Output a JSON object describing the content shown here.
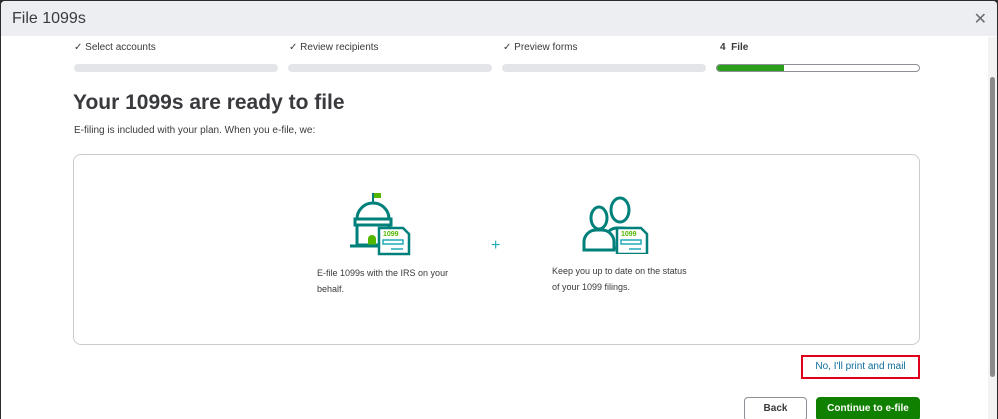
{
  "window": {
    "title": "File 1099s",
    "close_icon": "close-icon"
  },
  "steps": [
    {
      "label": "Select accounts",
      "done": true
    },
    {
      "label": "Review recipients",
      "done": true
    },
    {
      "label": "Preview forms",
      "done": true
    },
    {
      "label": "4  File",
      "done": false,
      "progress": 0.33
    }
  ],
  "check": "✓",
  "heading": "Your 1099s are ready to file",
  "subtitle": "E-filing is included with your plan. When you e-file, we:",
  "features": [
    {
      "icon": "government-building-1099-icon",
      "text": "E-file 1099s with the IRS on your behalf."
    },
    {
      "icon": "people-1099-icon",
      "text": "Keep you up to date on the status of your 1099 filings."
    }
  ],
  "plus": "+",
  "form_label": "1099",
  "print_mail_link": "No, I'll print and mail",
  "buttons": {
    "back": "Back",
    "continue": "Continue to e-file"
  },
  "colors": {
    "primary": "#108000",
    "progress": "#2ca01c",
    "teal": "#00807a",
    "link": "#0d6e9a",
    "highlight": "#e0001b"
  }
}
